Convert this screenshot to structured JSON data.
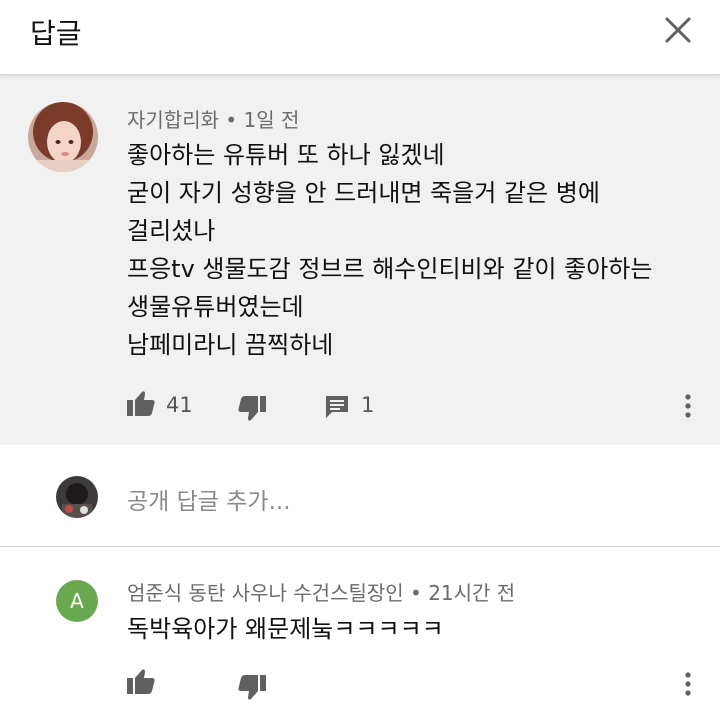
{
  "header": {
    "title": "답글",
    "close_icon": "close-icon"
  },
  "comment": {
    "author": "자기합리화",
    "separator": "•",
    "time": "1일 전",
    "lines": [
      "좋아하는 유튜버 또 하나 잃겠네",
      "굳이 자기 성향을 안 드러내면 죽을거 같은 병에",
      "걸리셨나",
      "프응tv 생물도감 정브르 해수인티비와 같이 좋아하는",
      "생물유튜버였는데",
      "남페미라니 끔찍하네"
    ],
    "like_count": "41",
    "reply_count": "1"
  },
  "add_reply": {
    "placeholder": "공개 답글 추가..."
  },
  "reply": {
    "avatar_letter": "A",
    "author": "엄준식 동탄 사우나 수건스틸장인",
    "separator": "•",
    "time": "21시간 전",
    "text": "독박육아가 왜문제눜ㅋㅋㅋㅋㅋ"
  },
  "colors": {
    "comment_bg": "#f1f1f1",
    "avatar_green": "#6aa84f",
    "icon_gray": "#606060"
  }
}
